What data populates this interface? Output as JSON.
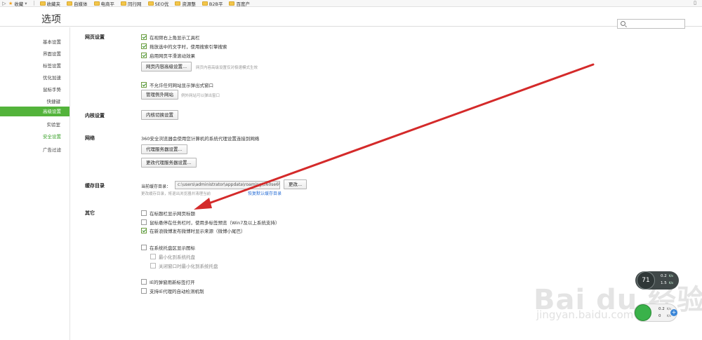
{
  "bookmarks": {
    "favorites_label": "收藏",
    "folders": [
      "收藏夹",
      "自媒体",
      "电商平",
      "同行网",
      "SEO优",
      "资源整",
      "B2B平",
      "百度产"
    ]
  },
  "header": {
    "title": "选项",
    "search_placeholder": ""
  },
  "sidebar": {
    "items": [
      "基本设置",
      "界面设置",
      "标签设置",
      "优化加速",
      "鼠标手势",
      "快捷键",
      "高级设置",
      "实验室",
      "安全设置",
      "广告过滤"
    ],
    "active_index": 6
  },
  "web_settings": {
    "label": "网页设置",
    "options": [
      {
        "text": "在视频右上角显示工具栏",
        "checked": true
      },
      {
        "text": "拖放选中的文字时，使用搜索引擎搜索",
        "checked": true
      },
      {
        "text": "启用网页平滑滚动效果",
        "checked": true
      }
    ],
    "advanced_button": "网页内容高级设置...",
    "advanced_hint": "网页内容高级设置仅对极速模式生效",
    "popup_option": {
      "text": "不允许任何网站显示弹出式窗口",
      "checked": true
    },
    "exceptions_button": "管理例外网站",
    "exceptions_hint": "例外网站可以弹出窗口"
  },
  "kernel": {
    "label": "内核设置",
    "button": "内核切换设置"
  },
  "network": {
    "label": "网络",
    "description": "360安全浏览器会使用您计算机的系统代理设置连接到网络",
    "proxy_button": "代理服务器设置...",
    "change_proxy_button": "更改代理服务器设置..."
  },
  "cache": {
    "label": "缓存目录",
    "current_label": "当前缓存目录：",
    "path": "c:\\users\\administrator\\appdata\\roaming\\360se6\\",
    "change_button": "更改...",
    "hint": "更改缓存目录，将退出浏览器并清理当前",
    "restore_link": "恢复默认缓存目录"
  },
  "other": {
    "label": "其它",
    "options": [
      {
        "text": "在标题栏显示网页标题",
        "checked": false
      },
      {
        "text": "鼠标悬停在任务栏时，使用多标签预览（Win7及以上系统支持）",
        "checked": false
      },
      {
        "text": "在新浪微博发布微博时显示来源（微博小尾巴）",
        "checked": true
      }
    ],
    "tray_option": {
      "text": "在系统托盘区显示图标",
      "checked": false
    },
    "tray_sub": [
      {
        "text": "最小化到系统托盘",
        "checked": false
      },
      {
        "text": "关闭窗口时最小化到系统托盘",
        "checked": false
      }
    ],
    "ie_options": [
      {
        "text": "IE的弹窗用新标签打开",
        "checked": false
      },
      {
        "text": "支持IE代理的自动检测机制",
        "checked": false
      }
    ]
  },
  "watermark": {
    "brand": "Bai du 经验",
    "url": "jingyan.baidu.com"
  },
  "widgets": {
    "speed_top": {
      "percent": "71",
      "up": "0.2",
      "down": "1.5",
      "up_unit": "K/s",
      "down_unit": "K/s"
    },
    "speed_bottom": {
      "up": "0.2",
      "down": "0",
      "up_unit": "K/s",
      "down_unit": "K/s"
    }
  },
  "annotation_color": "#d42a2a",
  "accent_color": "#53b33b"
}
